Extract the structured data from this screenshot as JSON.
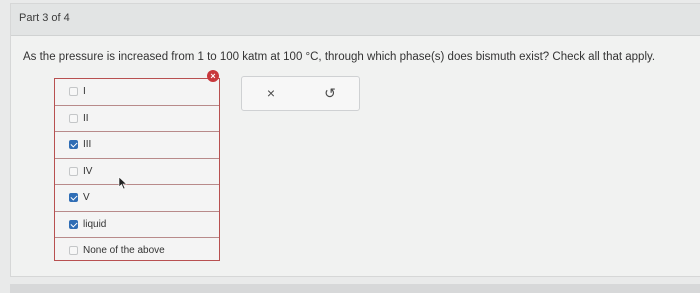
{
  "header": {
    "part_label": "Part 3 of 4"
  },
  "question": {
    "text": "As the pressure is increased from 1 to 100 katm at 100 °C, through which phase(s) does bismuth exist? Check all that apply."
  },
  "options": [
    {
      "label": "I",
      "checked": false
    },
    {
      "label": "II",
      "checked": false
    },
    {
      "label": "III",
      "checked": true
    },
    {
      "label": "IV",
      "checked": false
    },
    {
      "label": "V",
      "checked": true
    },
    {
      "label": "liquid",
      "checked": true
    },
    {
      "label": "None of the above",
      "checked": false
    }
  ],
  "feedback": {
    "badge_symbol": "×",
    "badge_color": "#c8383c"
  },
  "actions": {
    "clear_symbol": "×",
    "undo_symbol": "↺",
    "clear_icon": "close-icon",
    "undo_icon": "undo-icon"
  },
  "colors": {
    "checked": "#2f6db5",
    "incorrect_border": "#b85050"
  }
}
